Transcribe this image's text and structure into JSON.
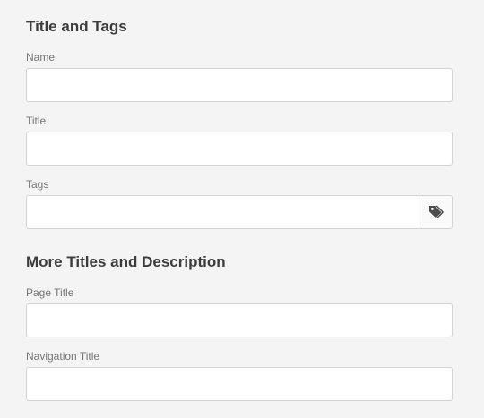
{
  "sections": [
    {
      "title": "Title and Tags",
      "fields": {
        "name": {
          "label": "Name",
          "value": "",
          "placeholder": ""
        },
        "title": {
          "label": "Title",
          "value": "",
          "placeholder": ""
        },
        "tags": {
          "label": "Tags",
          "value": "",
          "placeholder": "",
          "picker_icon": "tag-icon"
        }
      }
    },
    {
      "title": "More Titles and Description",
      "fields": {
        "page_title": {
          "label": "Page Title",
          "value": "",
          "placeholder": ""
        },
        "navigation_title": {
          "label": "Navigation Title",
          "value": "",
          "placeholder": ""
        }
      }
    }
  ],
  "colors": {
    "background": "#f4f4f4",
    "input_border": "#d3d3d3",
    "heading": "#3c3c3c",
    "label": "#747474",
    "icon": "#4b4b4b"
  }
}
